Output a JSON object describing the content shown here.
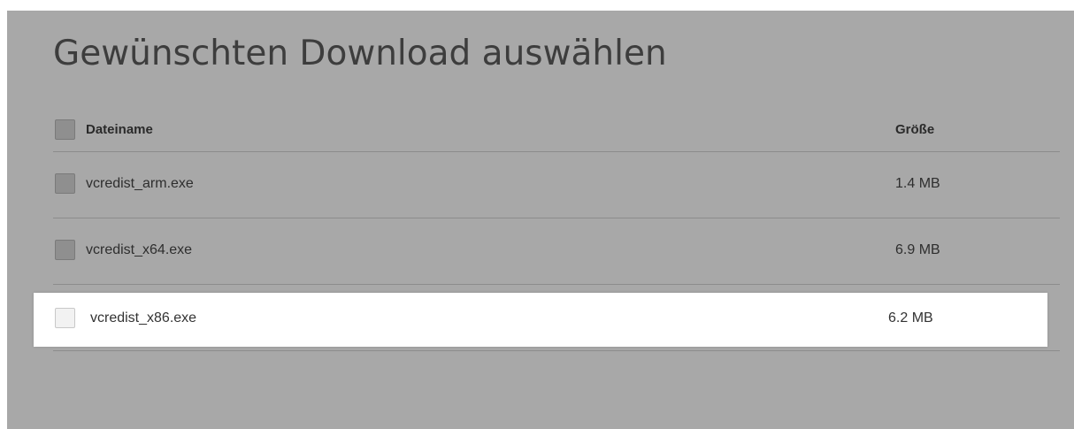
{
  "title": "Gewünschten Download auswählen",
  "table": {
    "header": {
      "name_label": "Dateiname",
      "size_label": "Größe"
    },
    "rows": [
      {
        "name": "vcredist_arm.exe",
        "size": "1.4 MB",
        "highlighted": false
      },
      {
        "name": "vcredist_x64.exe",
        "size": "6.9 MB",
        "highlighted": false
      },
      {
        "name": "vcredist_x86.exe",
        "size": "6.2 MB",
        "highlighted": true
      }
    ]
  },
  "colors": {
    "overlay_background": "#a8a8a8",
    "highlight_background": "#ffffff",
    "checkbox_disabled": "#8f8f8f"
  }
}
